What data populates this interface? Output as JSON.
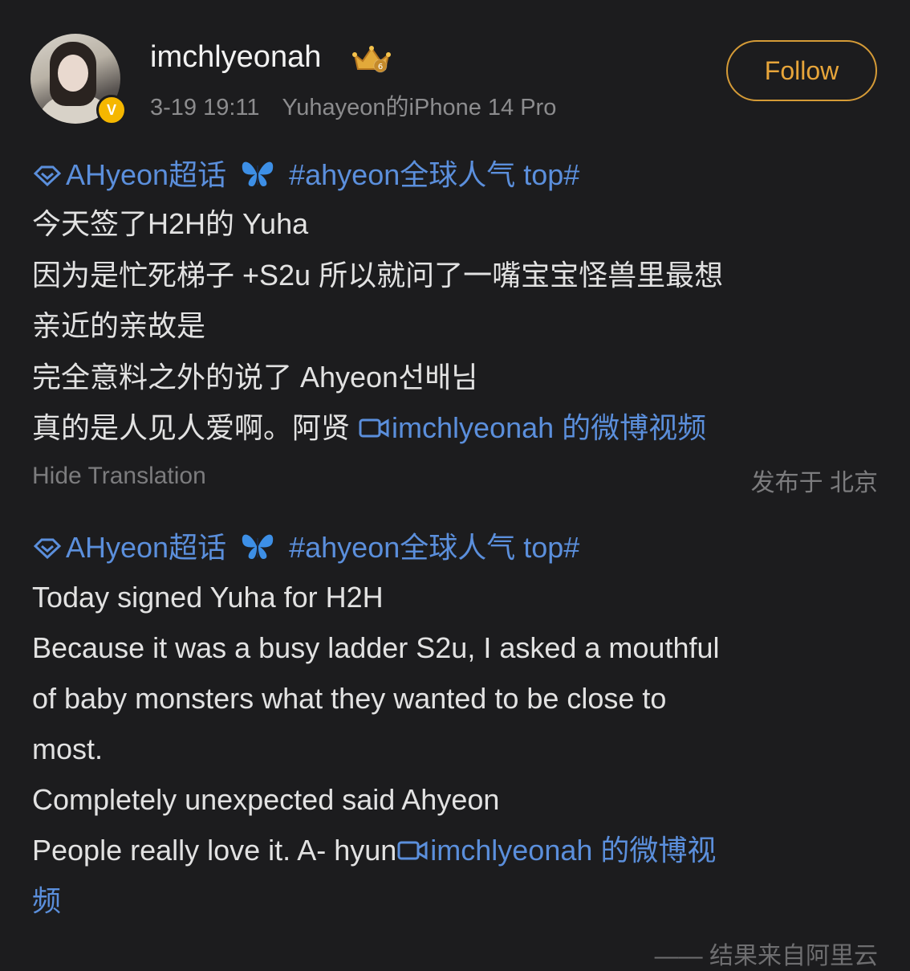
{
  "header": {
    "username": "imchlyeonah",
    "timestamp": "3-19 19:11",
    "device": "Yuhayeon的iPhone 14 Pro",
    "follow_label": "Follow",
    "verified_badge": "V"
  },
  "original": {
    "topic": "AHyeon超话",
    "hashtag": "#ahyeon全球人气 top#",
    "lines": [
      "今天签了H2H的 Yuha",
      "因为是忙死梯子 +S2u 所以就问了一嘴宝宝怪兽里最想",
      "亲近的亲故是",
      "完全意料之外的说了 Ahyeon선배님",
      "真的是人见人爱啊。阿贤 "
    ],
    "video_link": "imchlyeonah 的微博视频"
  },
  "translation_toggle": "Hide Translation",
  "location": "发布于 北京",
  "translated": {
    "topic": "AHyeon超话",
    "hashtag": "#ahyeon全球人气 top#",
    "lines": [
      "Today signed Yuha for H2H",
      "Because it was a busy ladder S2u, I asked a mouthful",
      "of baby monsters what they wanted to be close to",
      "most.",
      "Completely unexpected said Ahyeon",
      "People really love it. A- hyun"
    ],
    "video_link_part1": "imchlyeonah 的微博视",
    "video_link_part2": "频"
  },
  "credit": "—— 结果来自阿里云",
  "colors": {
    "background": "#1c1c1e",
    "link": "#5b8fdc",
    "follow": "#e7a53a",
    "verified": "#f5b700"
  },
  "icons": [
    "topic-diamond-icon",
    "butterfly-emoji-icon",
    "video-icon",
    "crown-badge-icon"
  ]
}
